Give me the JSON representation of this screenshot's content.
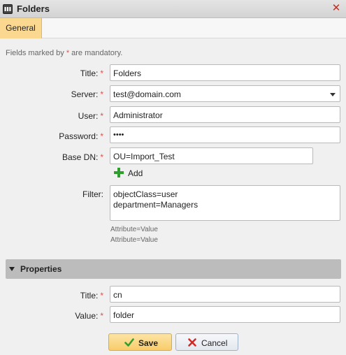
{
  "window": {
    "title": "Folders",
    "app_icon": "folder-app-icon",
    "close_icon": "close-icon",
    "accent_color": "#c92a1e"
  },
  "tabs": [
    {
      "label": "General",
      "active": true
    }
  ],
  "hint": {
    "prefix": "Fields marked by ",
    "star": "*",
    "suffix": " are mandatory."
  },
  "form": {
    "title": {
      "label": "Title:",
      "value": "Folders"
    },
    "server": {
      "label": "Server:",
      "value": "test@domain.com"
    },
    "user": {
      "label": "User:",
      "value": "Administrator"
    },
    "password": {
      "label": "Password:",
      "value": "••••"
    },
    "base_dn": {
      "label": "Base DN:",
      "value": "OU=Import_Test"
    },
    "add_label": "Add",
    "filter": {
      "label": "Filter:",
      "lines": [
        "objectClass=user",
        "department=Managers"
      ],
      "hints": [
        "Attribute=Value",
        "Attribute=Value"
      ]
    },
    "required_mark": "*"
  },
  "properties": {
    "section_title": "Properties",
    "title": {
      "label": "Title:",
      "value": "cn"
    },
    "value": {
      "label": "Value:",
      "value": "folder"
    }
  },
  "buttons": {
    "save": "Save",
    "cancel": "Cancel"
  },
  "colors": {
    "tab_active": "#fbd88f",
    "section_bg": "#bcbcbc",
    "required": "#d9534f",
    "add_icon": "#2f9e2f"
  }
}
